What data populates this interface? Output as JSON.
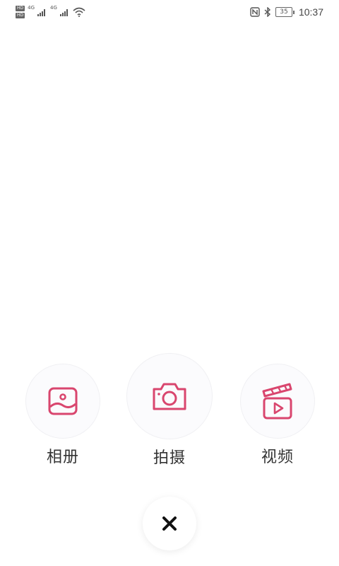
{
  "status_bar": {
    "hd_badges": [
      "HD",
      "HD"
    ],
    "network_1": "4G",
    "network_2": "4G",
    "icons": [
      "signal-icon",
      "wifi-icon",
      "nfc-icon",
      "bluetooth-icon",
      "battery-icon"
    ],
    "battery_level": "35",
    "time": "10:37"
  },
  "actions": {
    "album": {
      "label": "相册",
      "icon": "album-icon"
    },
    "camera": {
      "label": "拍摄",
      "icon": "camera-icon"
    },
    "video": {
      "label": "视频",
      "icon": "video-icon"
    }
  },
  "close": {
    "icon": "close-icon"
  },
  "colors": {
    "accent": "#d9466e",
    "circle_bg": "#fbfbfd",
    "text": "#333333"
  }
}
